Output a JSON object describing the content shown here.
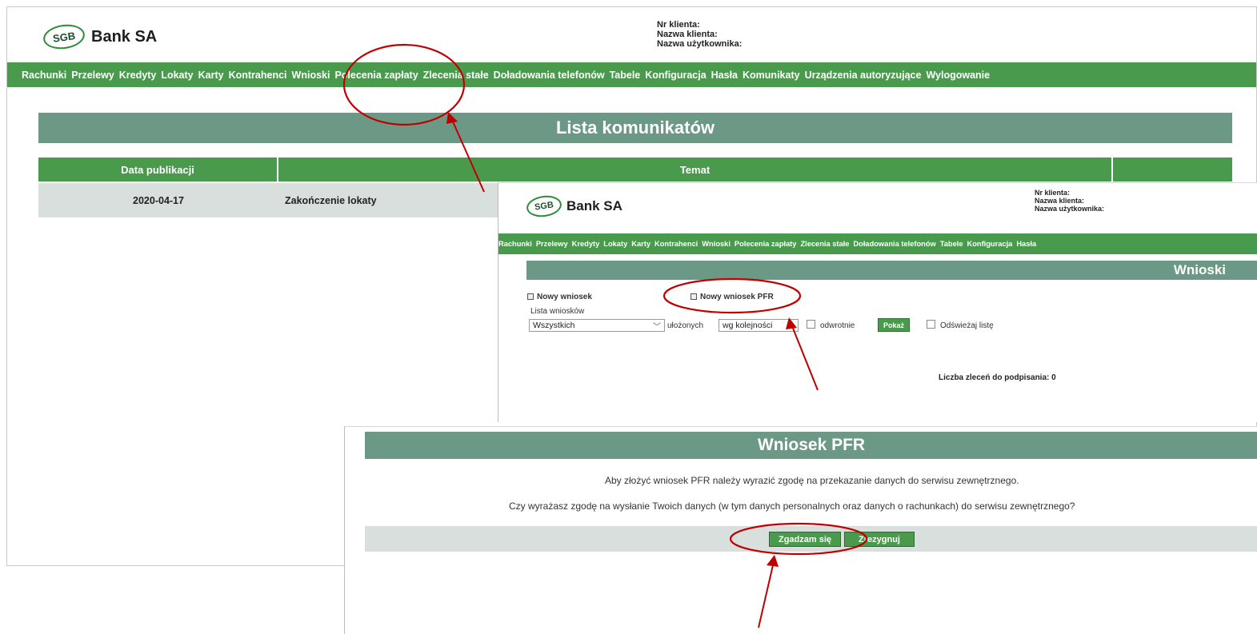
{
  "bank": {
    "logo_text": "SGB",
    "name": "Bank SA"
  },
  "client": {
    "nr_label": "Nr klienta:",
    "name_label": "Nazwa klienta:",
    "user_label": "Nazwa użytkownika:"
  },
  "nav_main": [
    "Rachunki",
    "Przelewy",
    "Kredyty",
    "Lokaty",
    "Karty",
    "Kontrahenci",
    "Wnioski",
    "Polecenia zapłaty",
    "Zlecenia stałe",
    "Doładowania telefonów",
    "Tabele",
    "Konfiguracja",
    "Hasła",
    "Komunikaty",
    "Urządzenia autoryzujące",
    "Wylogowanie"
  ],
  "nav_second": [
    "Rachunki",
    "Przelewy",
    "Kredyty",
    "Lokaty",
    "Karty",
    "Kontrahenci",
    "Wnioski",
    "Polecenia zapłaty",
    "Zlecenia stałe",
    "Doładowania telefonów",
    "Tabele",
    "Konfiguracja",
    "Hasła"
  ],
  "messages": {
    "title": "Lista komunikatów",
    "col_date": "Data publikacji",
    "col_subject": "Temat",
    "row_date": "2020-04-17",
    "row_subject": "Zakończenie lokaty"
  },
  "wnioski": {
    "title": "Wnioski",
    "new_request": "Nowy wniosek",
    "new_request_pfr": "Nowy wniosek PFR",
    "list_label": "Lista wniosków",
    "filter_value": "Wszystkich",
    "sorted_label": "ułożonych",
    "sort_value": "wg kolejności",
    "reverse_label": "odwrotnie",
    "show_button": "Pokaż",
    "refresh_label": "Odświeżaj listę",
    "count_text": "Liczba zleceń do podpisania: 0"
  },
  "pfr": {
    "title": "Wniosek PFR",
    "line1": "Aby złożyć wniosek PFR należy wyrazić zgodę na przekazanie danych do serwisu zewnętrznego.",
    "line2": "Czy wyrażasz zgodę na wysłanie Twoich danych (w tym danych personalnych oraz danych o rachunkach) do serwisu zewnętrznego?",
    "agree_button": "Zgadzam się",
    "cancel_button": "Zrezygnuj"
  },
  "colors": {
    "nav_green": "#4a9a4e",
    "banner_teal": "#6b9985",
    "highlight_red": "#c00000"
  }
}
